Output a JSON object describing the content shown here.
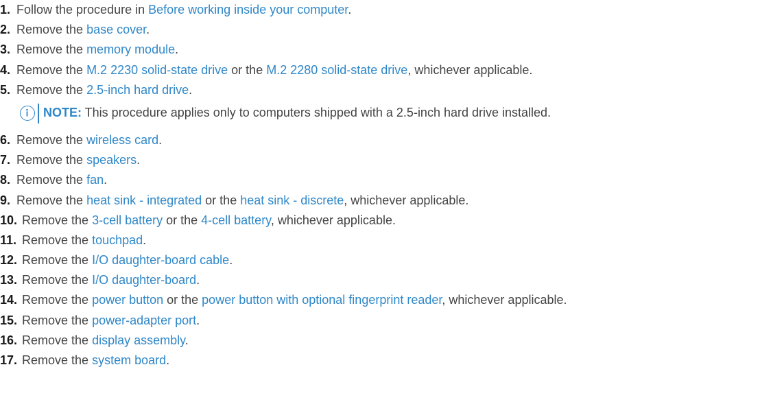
{
  "steps": [
    {
      "num": "1.",
      "parts": [
        {
          "t": "Follow the procedure in "
        },
        {
          "t": "Before working inside your computer",
          "link": true
        },
        {
          "t": "."
        }
      ]
    },
    {
      "num": "2.",
      "parts": [
        {
          "t": "Remove the "
        },
        {
          "t": "base cover",
          "link": true
        },
        {
          "t": "."
        }
      ]
    },
    {
      "num": "3.",
      "parts": [
        {
          "t": "Remove the "
        },
        {
          "t": "memory module",
          "link": true
        },
        {
          "t": "."
        }
      ]
    },
    {
      "num": "4.",
      "parts": [
        {
          "t": "Remove the "
        },
        {
          "t": "M.2 2230 solid-state drive",
          "link": true
        },
        {
          "t": " or the "
        },
        {
          "t": "M.2 2280 solid-state drive",
          "link": true
        },
        {
          "t": ", whichever applicable."
        }
      ]
    },
    {
      "num": "5.",
      "parts": [
        {
          "t": "Remove the "
        },
        {
          "t": "2.5-inch hard drive",
          "link": true
        },
        {
          "t": "."
        }
      ],
      "note": {
        "label": "NOTE:",
        "text": " This procedure applies only to computers shipped with a 2.5-inch hard drive installed."
      }
    },
    {
      "num": "6.",
      "parts": [
        {
          "t": "Remove the "
        },
        {
          "t": "wireless card",
          "link": true
        },
        {
          "t": "."
        }
      ]
    },
    {
      "num": "7.",
      "parts": [
        {
          "t": "Remove the "
        },
        {
          "t": "speakers",
          "link": true
        },
        {
          "t": "."
        }
      ]
    },
    {
      "num": "8.",
      "parts": [
        {
          "t": "Remove the "
        },
        {
          "t": "fan",
          "link": true
        },
        {
          "t": "."
        }
      ]
    },
    {
      "num": "9.",
      "parts": [
        {
          "t": "Remove the "
        },
        {
          "t": "heat sink - integrated",
          "link": true
        },
        {
          "t": " or the "
        },
        {
          "t": "heat sink - discrete",
          "link": true
        },
        {
          "t": ", whichever applicable."
        }
      ]
    },
    {
      "num": "10.",
      "parts": [
        {
          "t": "Remove the "
        },
        {
          "t": "3-cell battery",
          "link": true
        },
        {
          "t": " or the "
        },
        {
          "t": "4-cell battery",
          "link": true
        },
        {
          "t": ", whichever applicable."
        }
      ]
    },
    {
      "num": "11.",
      "parts": [
        {
          "t": "Remove the "
        },
        {
          "t": "touchpad",
          "link": true
        },
        {
          "t": "."
        }
      ]
    },
    {
      "num": "12.",
      "parts": [
        {
          "t": "Remove the "
        },
        {
          "t": "I/O daughter-board cable",
          "link": true
        },
        {
          "t": "."
        }
      ]
    },
    {
      "num": "13.",
      "parts": [
        {
          "t": "Remove the "
        },
        {
          "t": "I/O daughter-board",
          "link": true
        },
        {
          "t": "."
        }
      ]
    },
    {
      "num": "14.",
      "parts": [
        {
          "t": "Remove the "
        },
        {
          "t": "power button",
          "link": true
        },
        {
          "t": " or the "
        },
        {
          "t": "power button with optional fingerprint reader",
          "link": true
        },
        {
          "t": ", whichever applicable."
        }
      ]
    },
    {
      "num": "15.",
      "parts": [
        {
          "t": "Remove the "
        },
        {
          "t": "power-adapter port",
          "link": true
        },
        {
          "t": "."
        }
      ]
    },
    {
      "num": "16.",
      "parts": [
        {
          "t": "Remove the "
        },
        {
          "t": "display assembly",
          "link": true
        },
        {
          "t": "."
        }
      ]
    },
    {
      "num": "17.",
      "parts": [
        {
          "t": "Remove the "
        },
        {
          "t": "system board",
          "link": true
        },
        {
          "t": "."
        }
      ]
    }
  ],
  "colors": {
    "link": "#2f87c8",
    "text": "#444444",
    "number": "#1a1a1a",
    "note_accent": "#2f87c8"
  },
  "icons": {
    "note": "info-circle-icon"
  }
}
